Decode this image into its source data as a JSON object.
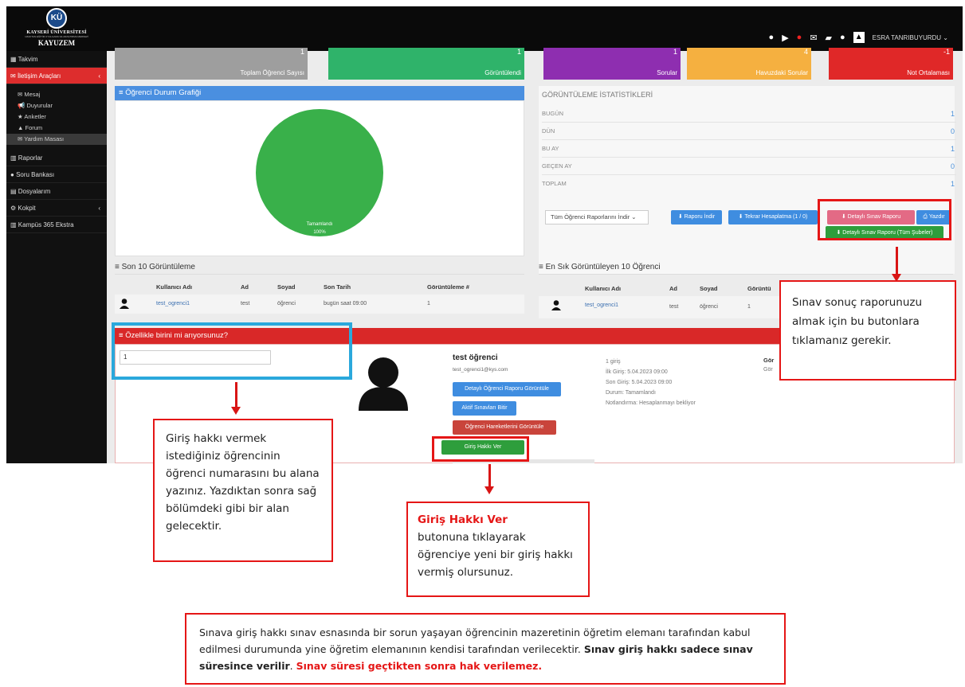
{
  "logo": {
    "monogram": "KÜ",
    "university": "KAYSERİ ÜNİVERSİTESİ",
    "subtitle": "UZAKTAN EĞİTİM UYGULAMA VE ARAŞTIRMA MERKEZİ",
    "short": "KAYUZEM"
  },
  "topbar": {
    "user": "ESRA TANRIBUYURDU"
  },
  "sidebar": {
    "items": [
      {
        "label": "Takvim",
        "icon": "calendar-icon"
      },
      {
        "label": "İletişim Araçları",
        "icon": "chat-icon"
      },
      {
        "label": "Raporlar",
        "icon": "chart-icon"
      },
      {
        "label": "Soru Bankası",
        "icon": "question-icon"
      },
      {
        "label": "Dosyalarım",
        "icon": "file-icon"
      },
      {
        "label": "Kokpit",
        "icon": "cockpit-icon"
      },
      {
        "label": "Kampüs 365 Ekstra",
        "icon": "chart-icon"
      }
    ],
    "subitems": [
      "Mesaj",
      "Duyurular",
      "Anketler",
      "Forum",
      "Yardım Masası"
    ]
  },
  "cards": [
    {
      "label": "Toplam Öğrenci Sayısı",
      "value": "1",
      "color": "#9e9e9e"
    },
    {
      "label": "Görüntülendi",
      "value": "1",
      "color": "#2fb36a"
    },
    {
      "label": "Sorular",
      "value": "1",
      "color": "#8e2eb0"
    },
    {
      "label": "Havuzdaki Sorular",
      "value": "4",
      "color": "#f5b040"
    },
    {
      "label": "Not Ortalaması",
      "value": "-1",
      "color": "#e02828"
    }
  ],
  "chart_panel": {
    "title": "Öğrenci Durum Grafiği",
    "slice_label": "Tamamlandı",
    "slice_percent": "100%"
  },
  "chart_data": {
    "type": "pie",
    "categories": [
      "Tamamlandı"
    ],
    "values": [
      100
    ]
  },
  "stats": {
    "title": "GÖRÜNTÜLEME İSTATİSTİKLERİ",
    "rows": [
      {
        "label": "BUGÜN",
        "value": "1"
      },
      {
        "label": "DÜN",
        "value": "0"
      },
      {
        "label": "BU AY",
        "value": "1"
      },
      {
        "label": "GEÇEN AY",
        "value": "0"
      },
      {
        "label": "TOPLAM",
        "value": "1"
      }
    ]
  },
  "report_controls": {
    "select_value": "Tüm Öğrenci Raporlarını İndir",
    "download_btn": "Raporu İndir",
    "recalc_btn": "Tekrar Hesaplatma (1 / 0)",
    "detail_btn": "Detaylı Sınav Raporu",
    "print_btn": "Yazdır",
    "detail_all_btn": "Detaylı Sınav Raporu (Tüm Şubeler)"
  },
  "last_views": {
    "title": "Son 10 Görüntüleme",
    "headers": [
      "Kullanıcı Adı",
      "Ad",
      "Soyad",
      "Son Tarih",
      "Görüntüleme #"
    ],
    "row": [
      "test_ogrenci1",
      "test",
      "öğrenci",
      "bugün saat 09:00",
      "1"
    ]
  },
  "top_views": {
    "title": "En Sık Görüntüleyen 10 Öğrenci",
    "headers": [
      "Kullanıcı Adı",
      "Ad",
      "Soyad",
      "Görüntü"
    ],
    "row": [
      "test_ogrenci1",
      "test",
      "öğrenci",
      "1"
    ]
  },
  "search_panel": {
    "title": "Özellikle birini mi arıyorsunuz?",
    "input_value": "1"
  },
  "student": {
    "name": "test öğrenci",
    "email": "test_ogrenci1@kys.com",
    "btn_report": "Detaylı Öğrenci Raporu Görüntüle",
    "btn_end": "Aktif Sınavları Bitir",
    "btn_moves": "Öğrenci Hareketlerini Görüntüle",
    "btn_grant": "Giriş Hakkı Ver",
    "logins": "1 giriş",
    "first": "İlk Giriş: 5.04.2023 09:00",
    "last": "Son Giriş: 5.04.2023 09:00",
    "status": "Durum: Tamamlandı",
    "grading": "Notlandırma: Hesaplanmayı bekliyor",
    "right_head": "Gör",
    "right_sub": "Gör"
  },
  "annotations": {
    "report_note": "Sınav sonuç raporunuzu almak için bu butonlara tıklamanız gerekir.",
    "input_note": "Giriş hakkı vermek istediğiniz öğrencinin öğrenci numarasını bu alana yazınız. Yazdıktan sonra sağ bölümdeki gibi bir alan gelecektir.",
    "grant_title": "Giriş Hakkı Ver",
    "grant_note": "butonuna tıklayarak öğrenciye yeni bir giriş hakkı vermiş olursunuz.",
    "bottom_text": "Sınava giriş hakkı sınav esnasında bir sorun yaşayan öğrencinin mazeretinin öğretim elemanı tarafından kabul edilmesi durumunda yine öğretim elemanının kendisi tarafından verilecektir.",
    "bottom_bold": "Sınav giriş hakkı sadece sınav süresince verilir",
    "bottom_dot": ".",
    "bottom_red": "Sınav süresi geçtikten sonra hak verilemez."
  }
}
